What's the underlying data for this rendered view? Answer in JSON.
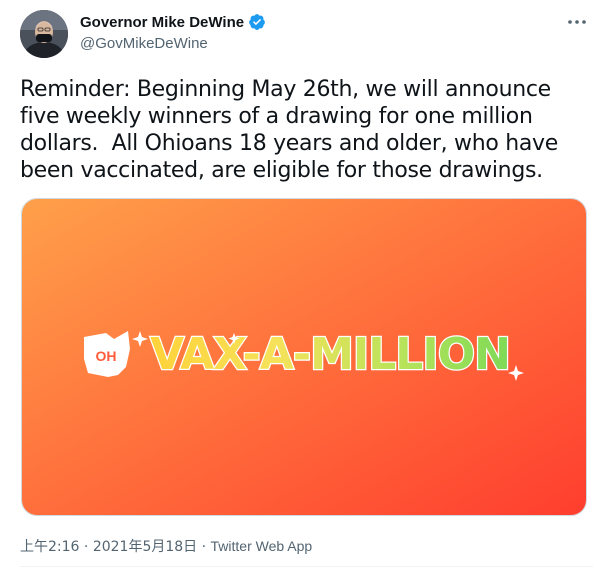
{
  "author": {
    "display_name": "Governor Mike DeWine",
    "handle": "@GovMikeDeWine",
    "verified": true,
    "avatar_icon": "profile-photo-icon"
  },
  "tweet": {
    "text": "Reminder: Beginning May 26th, we will announce five weekly winners of a drawing for one million dollars.  All Ohioans 18 years and older, who have been vaccinated, are eligible for those drawings."
  },
  "media": {
    "logo_state": "OH",
    "logo_text": "VAX-A-MILLION",
    "gradient_start": "#ff9a45",
    "gradient_end": "#ff3f2e"
  },
  "meta": {
    "time": "上午2:16",
    "separator": " · ",
    "date": "2021年5月18日",
    "source": "Twitter Web App"
  },
  "colors": {
    "verified": "#1d9bf0",
    "secondary_text": "#536471"
  }
}
